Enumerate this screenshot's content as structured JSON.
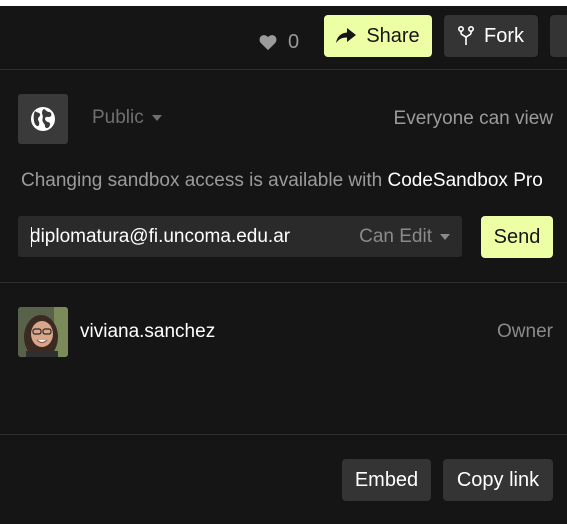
{
  "header": {
    "like_count": "0",
    "share_label": "Share",
    "fork_label": "Fork"
  },
  "access": {
    "visibility": "Public",
    "visibility_note": "Everyone can view",
    "pro_note_prefix": "Changing sandbox access is available with ",
    "pro_note_product": "CodeSandbox Pro"
  },
  "invite": {
    "email_value": "diplomatura@fi.uncoma.edu.ar",
    "permission": "Can Edit",
    "send_label": "Send"
  },
  "members": [
    {
      "name": "viviana.sanchez",
      "role": "Owner"
    }
  ],
  "footer": {
    "embed_label": "Embed",
    "copy_link_label": "Copy link"
  },
  "colors": {
    "background": "#151515",
    "accent": "#edffa5",
    "button_dark": "#343434"
  }
}
